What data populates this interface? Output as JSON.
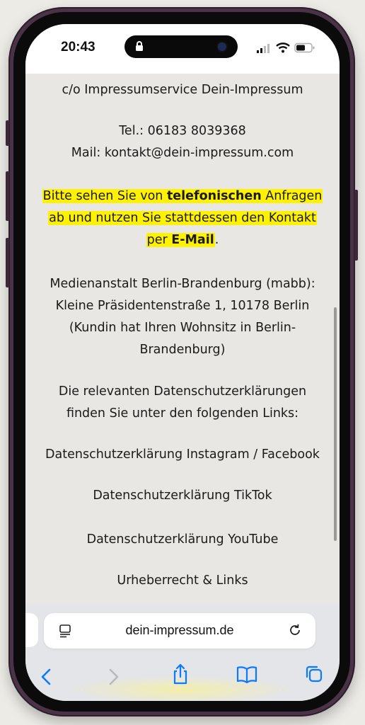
{
  "status_bar": {
    "time": "20:43"
  },
  "content": {
    "lines": [
      "c/o Impressumservice Dein-Impressum",
      "Tel.: 06183 8039368",
      "Mail: kontakt@dein-impressum.com",
      "Medienanstalt Berlin-Brandenburg (mabb):",
      "Kleine Präsidentenstraße 1, 10178 Berlin",
      "(Kundin hat Ihren Wohnsitz in Berlin-",
      "Brandenburg)",
      "Die relevanten Datenschutzerklärungen",
      "finden Sie unter den folgenden Links:"
    ],
    "notice": {
      "part1": "Bitte sehen Sie von ",
      "bold1": "telefonischen",
      "part2": " Anfragen",
      "line2": "ab und nutzen Sie stattdessen den Kontakt",
      "part3": "per ",
      "bold2": "E-Mail",
      "part4": "."
    },
    "links": [
      "Datenschutzerklärung Instagram / Facebook",
      "Datenschutzerklärung TikTok",
      "Datenschutzerklärung YouTube",
      "Urheberrecht & Links"
    ]
  },
  "browser": {
    "url": "dein-impressum.de",
    "left_icon": "reader-icon",
    "right_icon": "reload-icon",
    "toolbar_icons": [
      "back-icon",
      "forward-icon",
      "share-icon",
      "bookmarks-icon",
      "tabs-icon"
    ]
  },
  "colors": {
    "highlight": "#fff200",
    "accent": "#0a7aff",
    "page_bg": "#e9e7e3",
    "frame": "#4a3346"
  }
}
